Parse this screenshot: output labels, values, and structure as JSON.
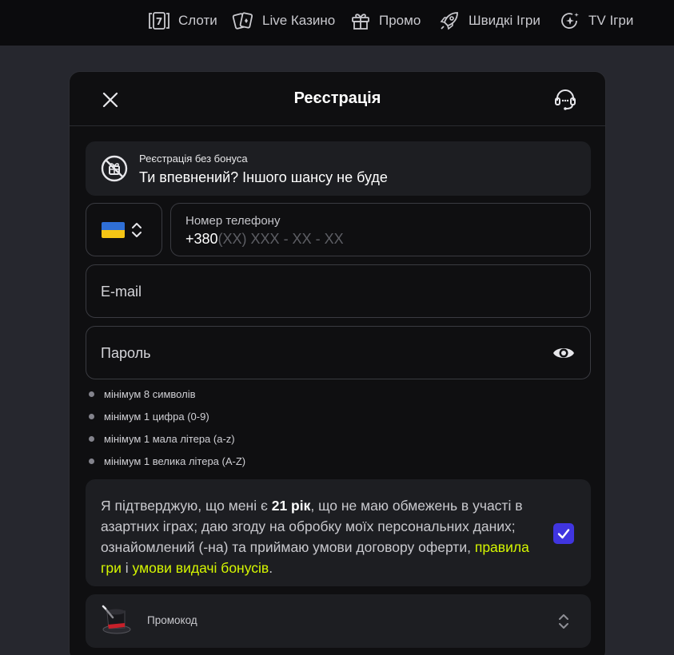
{
  "nav": {
    "items": [
      {
        "label": "Слоти",
        "icon": "slot-7-icon"
      },
      {
        "label": "Live Казино",
        "icon": "playing-cards-icon"
      },
      {
        "label": "Промо",
        "icon": "gift-icon"
      },
      {
        "label": "Швидкі Ігри",
        "icon": "rocket-icon"
      },
      {
        "label": "TV Ігри",
        "icon": "sparkle-icon"
      }
    ]
  },
  "modal": {
    "title": "Реєстрація",
    "no_bonus": {
      "label": "Реєстрація без бонуса",
      "text": "Ти впевнений? Іншого шансу не буде"
    },
    "phone": {
      "label": "Номер телефону",
      "prefix": "+380",
      "mask": "(XX) XXX - XX - XX"
    },
    "email": {
      "placeholder": "E-mail"
    },
    "password": {
      "placeholder": "Пароль"
    },
    "rules": [
      "мінімум 8 символів",
      "мінімум 1 цифра (0-9)",
      "мінімум 1 мала літера (a-z)",
      "мінімум 1 велика літера (A-Z)"
    ],
    "consent": {
      "text_before": "Я підтверджую, що мені є ",
      "age": "21 рік",
      "text_after": ", що не маю обмежень в участі в азартних іграх; даю згоду на обробку моїх персональних даних; ознайомлений (-на) та приймаю умови договору оферти,",
      "link_rules": "правила гри",
      "conjunction": "і",
      "link_bonus": "умови видачі бонусів",
      "end": ".",
      "checked": true
    },
    "promo": {
      "label": "Промокод"
    }
  },
  "colors": {
    "accent": "#4035e0",
    "link": "#d6f700",
    "background": "#26272e",
    "modal_background": "#0f0f11",
    "card_background": "#1d1e22"
  }
}
